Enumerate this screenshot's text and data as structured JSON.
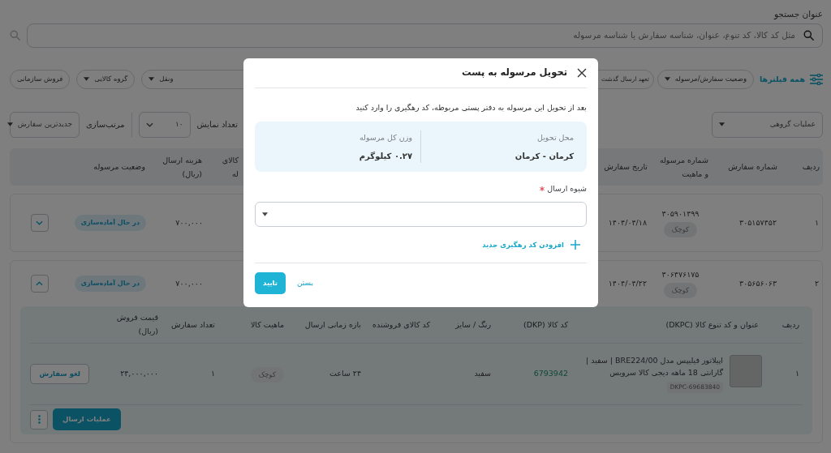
{
  "search": {
    "label": "عنوان جستجو",
    "placeholder": "مثل کد کالا، کد تنوع، عنوان، شناسه سفارش یا شناسه مرسوله"
  },
  "filters": {
    "all_label": "همه فیلترها",
    "chips": [
      {
        "label": "وضعیت سفارش/مرسوله",
        "kind": "dropdown"
      },
      {
        "label": "تعهد ارسال گذشت",
        "kind": "toggle"
      },
      {
        "label": "ونقل",
        "kind": "dropdown"
      },
      {
        "label": "گروه کالایی",
        "kind": "dropdown"
      },
      {
        "label": "فروش سازمانی",
        "kind": "toggle"
      }
    ]
  },
  "toolbar": {
    "bulk_placeholder": "عملیات گروهی",
    "page_size_label": "تعداد نمایش",
    "page_size": "۱۰",
    "sort_label": "مرتب‌سازی",
    "sort": "جدیدترین سفارش"
  },
  "table": {
    "columns": [
      "ردیف",
      "شماره سفارش",
      "شماره مرسوله و ماهیت",
      "تاریخ سفارش",
      "هزینه ارسال (ریال)",
      "وضعیت مرسوله"
    ],
    "partial_column": [
      "کالای",
      "له"
    ],
    "rows": [
      {
        "index": "۱",
        "order_no": "۳۰۵۱۵۷۴۵۲",
        "shipment_no": "۳۰۵۹۰۱۴۹۹",
        "size": "کوچک",
        "date": "۱۴۰۴/۰۴/۱۸",
        "shipping_cost": "۷۰۰,۰۰۰",
        "status": "در حال آماده‌سازی",
        "expanded": false
      },
      {
        "index": "۲",
        "order_no": "۳۰۵۶۵۶۰۶۳",
        "shipment_no": "۳۰۶۴۷۶۱۷۵",
        "size": "کوچک",
        "date": "۱۴۰۴/۰۴/۲۲",
        "shipping_cost": "۷۰۰,۰۰۰",
        "status": "در حال آماده‌سازی",
        "expanded": true,
        "details": {
          "columns": [
            "ردیف",
            "عنوان و کد تنوع کالا (DKPC)",
            "کد کالا (DKP)",
            "رنگ / سایز",
            "کد کالای فروشنده",
            "بازه زمانی ارسال",
            "ماهیت کالا",
            "تعداد سفارش",
            "قیمت فروش (ریال)"
          ],
          "items": [
            {
              "index": "۱",
              "title": "اپیلاتور فیلیپس مدل BRE224/00 | سفید | گارانتی 18 ماهه دیجی کالا سرویس",
              "dkpc": "DKPC-69683840",
              "dkp": "6793942",
              "color_size": "سفید",
              "delivery_window": "۲۴ ساعت",
              "nature": "کوچک",
              "quantity": "۱",
              "price": "۲۴,۰۰۰,۰۰۰",
              "action": "لغو سفارش"
            }
          ],
          "primary_action": "عملیات ارسال"
        }
      }
    ]
  },
  "modal": {
    "title": "تحویل مرسوله به پست",
    "description": "بعد از تحویل این مرسوله به دفتر پستی مربوطه، کد رهگیری را وارد کنید",
    "info": [
      {
        "label": "محل تحویل",
        "value": "کرمان - کرمان"
      },
      {
        "label": "وزن کل مرسوله",
        "value": "۰.۲۷ کیلوگرم"
      }
    ],
    "field": {
      "label": "شیوه ارسال",
      "required": true
    },
    "add_link": "افزودن کد رهگیری جدید",
    "close_button": "بستن",
    "confirm_button": "تایید"
  }
}
